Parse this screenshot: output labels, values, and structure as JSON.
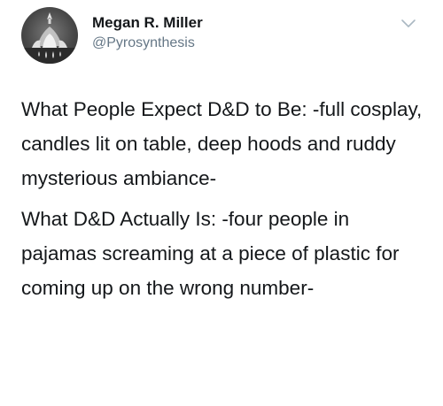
{
  "author": {
    "display_name": "Megan R. Miller",
    "handle": "@Pyrosynthesis",
    "avatar_icon": "flame-emblem-icon"
  },
  "menu": {
    "icon": "chevron-down-icon"
  },
  "tweet": {
    "paragraphs": [
      "What People Expect D&D to Be: -full cosplay, candles lit on table, deep hoods and ruddy mysterious ambiance-",
      "What D&D Actually Is: -four people in pajamas screaming at a piece of plastic for coming up on the wrong number-"
    ]
  },
  "colors": {
    "text": "#14171a",
    "secondary_text": "#657786",
    "icon": "#aab8c2"
  }
}
